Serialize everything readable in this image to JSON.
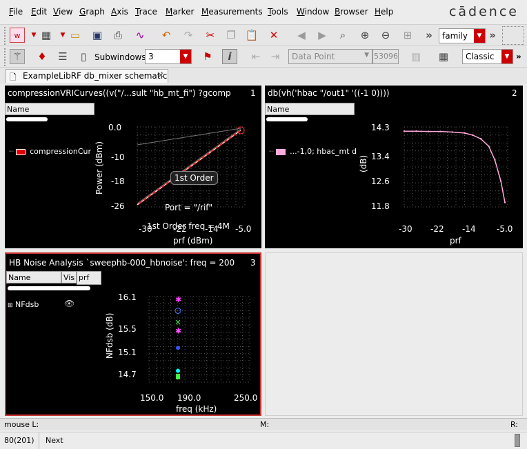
{
  "menu": [
    "File",
    "Edit",
    "View",
    "Graph",
    "Axis",
    "Trace",
    "Marker",
    "Measurements",
    "Tools",
    "Window",
    "Browser",
    "Help"
  ],
  "brand": "cādence",
  "toolbar1": {
    "family_combo": "family",
    "more1": "»",
    "more2": "»"
  },
  "toolbar2": {
    "subwindows_label": "Subwindows:",
    "subwindows_value": "3",
    "data_point_combo": "Data Point",
    "value_field": "53096",
    "classic_combo": "Classic"
  },
  "tab": {
    "label": "ExampleLibRF db_mixer schematic"
  },
  "pane1": {
    "title": "compressionVRICurves((v(\"/...sult \"hb_mt_fi\") ?gcomp",
    "number": "1",
    "legend_header": "Name",
    "legend_entry": "compressionCur",
    "legend_color": "#e00000",
    "ylabel": "Power (dBm)",
    "yticks": [
      "0.0",
      "-10",
      "-18",
      "-26"
    ],
    "xticks": [
      "-30",
      "-22",
      "-14",
      "-5.0"
    ],
    "xlabel": "prf (dBm)",
    "callout": "1st Order",
    "annot_port": "Port = \"/rif\"",
    "annot_freq": "1st Order freq = 4M"
  },
  "pane2": {
    "title": "db(vh('hbac \"/out1\" '((-1 0))))",
    "number": "2",
    "legend_header": "Name",
    "legend_entry": "...-1,0; hbac_mt d",
    "legend_color": "#ffaadd",
    "ylabel": "(dB)",
    "yticks": [
      "14.3",
      "13.4",
      "12.6",
      "11.8"
    ],
    "xticks": [
      "-30",
      "-22",
      "-14",
      "-5.0"
    ],
    "xlabel": "prf"
  },
  "pane3": {
    "title": "HB Noise Analysis `sweephb-000_hbnoise': freq = 200",
    "number": "3",
    "legend_headers": [
      "Name",
      "Vis",
      "prf"
    ],
    "legend_entry": "NFdsb",
    "ylabel": "NFdsb (dB)",
    "yticks": [
      "16.1",
      "15.5",
      "15.1",
      "14.7"
    ],
    "xticks": [
      "150.0",
      "190.0",
      "250.0"
    ],
    "xlabel": "freq (kHz)"
  },
  "status": {
    "left": "mouse L:",
    "middle": "M:",
    "right": "R:"
  },
  "bottom": {
    "counter": "80(201)",
    "next": "Next"
  },
  "chart_data": [
    {
      "type": "line",
      "title": "compressionVRICurves((v(\"/...sult \"hb_mt_fi\") ?gcomp",
      "xlabel": "prf (dBm)",
      "ylabel": "Power (dBm)",
      "xlim": [
        -30,
        -5
      ],
      "ylim": [
        -26,
        0
      ],
      "series": [
        {
          "name": "compressionCur",
          "x": [
            -30,
            -5
          ],
          "y": [
            -26,
            0
          ]
        }
      ]
    },
    {
      "type": "line",
      "title": "db(vh('hbac \"/out1\" '((-1 0))))",
      "xlabel": "prf",
      "ylabel": "(dB)",
      "xlim": [
        -30,
        -5
      ],
      "ylim": [
        11.8,
        14.3
      ],
      "series": [
        {
          "name": "...-1,0; hbac_mt d",
          "x": [
            -30,
            -27,
            -24,
            -21,
            -18,
            -15,
            -13,
            -11,
            -9,
            -7.5,
            -6,
            -5
          ],
          "y": [
            14.25,
            14.25,
            14.24,
            14.24,
            14.22,
            14.19,
            14.12,
            14.0,
            13.75,
            13.3,
            12.6,
            11.9
          ]
        }
      ]
    },
    {
      "type": "scatter",
      "title": "HB Noise Analysis `sweephb-000_hbnoise': freq = 200",
      "xlabel": "freq (kHz)",
      "ylabel": "NFdsb (dB)",
      "xlim": [
        150,
        250
      ],
      "ylim": [
        14.7,
        16.1
      ],
      "series": [
        {
          "name": "NFdsb",
          "x": [
            200,
            200,
            200,
            200,
            200,
            200,
            200
          ],
          "y": [
            16.1,
            15.9,
            15.7,
            15.55,
            15.25,
            14.85,
            14.75
          ]
        }
      ]
    }
  ]
}
